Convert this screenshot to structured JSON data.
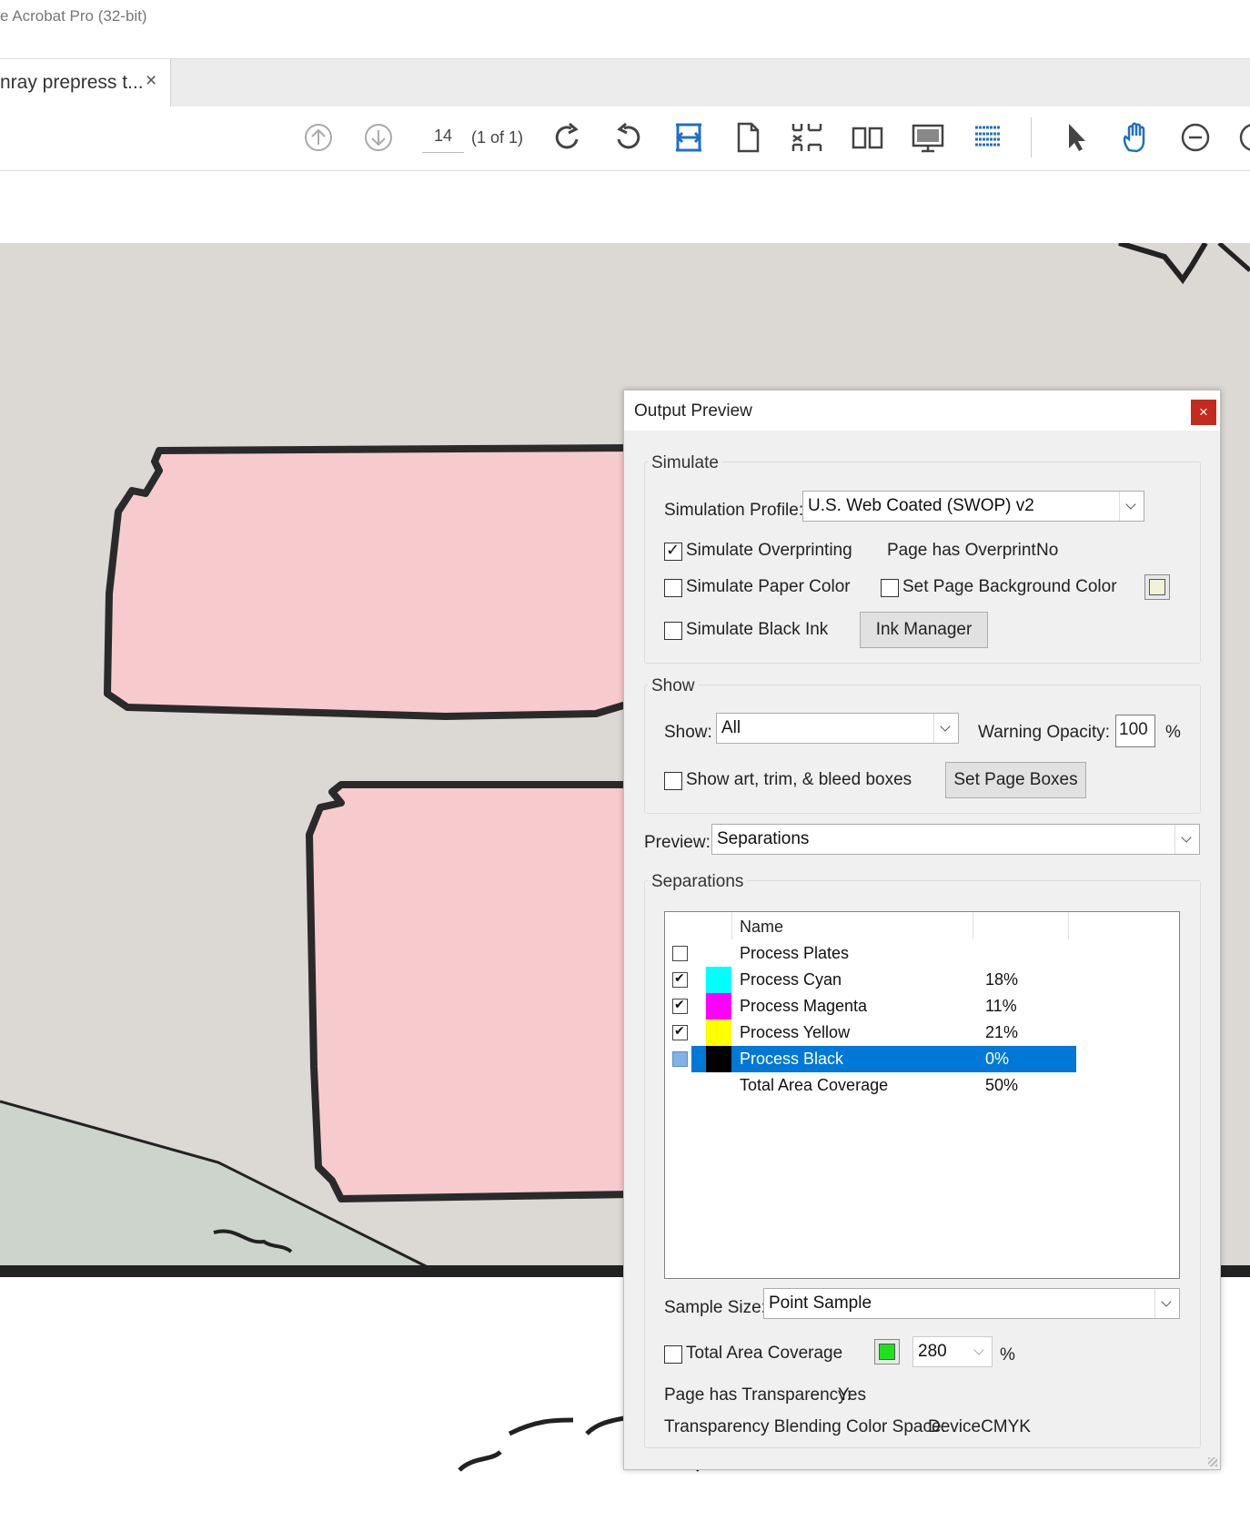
{
  "window": {
    "title": "e Acrobat Pro (32-bit)"
  },
  "tabs": [
    {
      "label": "nray prepress t...",
      "close": "×"
    }
  ],
  "toolbar": {
    "page_number": "14",
    "page_count": "(1 of 1)",
    "icons": [
      "prev-page-icon",
      "next-page-icon",
      "rotate-cw-icon",
      "rotate-ccw-icon",
      "fit-width-icon",
      "single-page-icon",
      "fit-page-icon",
      "two-page-icon",
      "presentation-icon",
      "scroll-mode-icon",
      "select-arrow-icon",
      "hand-tool-icon",
      "zoom-out-icon"
    ]
  },
  "dialog": {
    "title": "Output Preview",
    "close": "×",
    "simulate": {
      "legend": "Simulate",
      "profile_label": "Simulation Profile:",
      "profile_value": "U.S. Web Coated (SWOP) v2",
      "simulate_overprinting": {
        "label": "Simulate Overprinting",
        "checked": true
      },
      "page_overprint_label": "Page has Overprint:",
      "page_overprint_value": "No",
      "simulate_paper_color": {
        "label": "Simulate Paper Color",
        "checked": false
      },
      "set_bg_color": {
        "label": "Set Page Background Color",
        "checked": false
      },
      "simulate_black_ink": {
        "label": "Simulate Black Ink",
        "checked": false
      },
      "ink_manager_label": "Ink Manager"
    },
    "show": {
      "legend": "Show",
      "show_label": "Show:",
      "show_value": "All",
      "warning_opacity_label": "Warning Opacity:",
      "warning_opacity_value": "100",
      "percent": "%",
      "show_boxes": {
        "label": "Show art, trim, & bleed boxes",
        "checked": false
      },
      "set_page_boxes_label": "Set Page Boxes"
    },
    "preview": {
      "label": "Preview:",
      "value": "Separations"
    },
    "separations": {
      "legend": "Separations",
      "column_name": "Name",
      "rows": [
        {
          "name": "Process Plates",
          "percent": "",
          "checked": false,
          "color": ""
        },
        {
          "name": "Process Cyan",
          "percent": "18%",
          "checked": true,
          "color": "#00ffff"
        },
        {
          "name": "Process Magenta",
          "percent": "11%",
          "checked": true,
          "color": "#ff00ff"
        },
        {
          "name": "Process Yellow",
          "percent": "21%",
          "checked": true,
          "color": "#ffff00"
        },
        {
          "name": "Process Black",
          "percent": "0%",
          "checked": false,
          "color": "#000000",
          "selected": true
        },
        {
          "name": "Total Area Coverage",
          "percent": "50%",
          "checked": null,
          "color": ""
        }
      ]
    },
    "sample_size": {
      "label": "Sample Size:",
      "value": "Point Sample"
    },
    "total_area_coverage": {
      "label": "Total Area Coverage",
      "checked": false,
      "swatch_color": "#1de31d",
      "value": "280",
      "percent": "%"
    },
    "transparency_label": "Page has Transparency:",
    "transparency_value": "Yes",
    "blending_label": "Transparency Blending Color Space:",
    "blending_value": "DeviceCMYK"
  },
  "colors": {
    "canvas_bg": "#dcd8d4",
    "pink_fill": "#f7cbce",
    "green_fill": "#cdd4cc",
    "accent_blue": "#1f6fc9",
    "selection": "#0078d7"
  }
}
